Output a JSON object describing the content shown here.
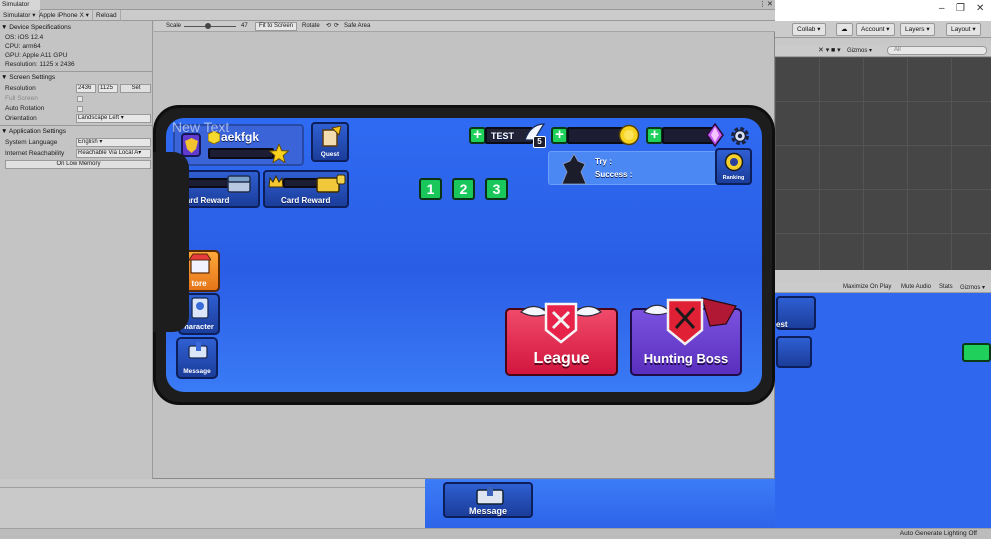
{
  "window": {
    "tab_title": "Simulator",
    "controls": [
      "–",
      "❐",
      "✕"
    ]
  },
  "sim_toolbar": {
    "mode": "Simulator ▾",
    "device": "Apple iPhone X ▾",
    "reload": "Reload"
  },
  "device_specs": {
    "header": "Device Specifications",
    "os": "OS: iOS 12.4",
    "cpu": "CPU: arm64",
    "gpu": "GPU: Apple A11 GPU",
    "resolution": "Resolution: 1125 x 2436"
  },
  "screen_settings": {
    "header": "Screen Settings",
    "resolution_label": "Resolution",
    "res_w": "2436",
    "res_h": "1125",
    "set_label": "Set",
    "full_screen": "Full Screen",
    "auto_rotation": "Auto Rotation",
    "orientation_label": "Orientation",
    "orientation_value": "Landscape Left ▾"
  },
  "app_settings": {
    "header": "Application Settings",
    "language_label": "System Language",
    "language_value": "English ▾",
    "reachability_label": "Internet Reachability",
    "reachability_value": "Reachable Via Local A▾",
    "low_memory": "On Low Memory"
  },
  "device_toolbar": {
    "scale_label": "Scale",
    "scale_value": "47",
    "fit": "Fit to Screen",
    "rotate": "Rotate",
    "safe_area": "Safe Area"
  },
  "editor": {
    "collab": "Collab ▾",
    "account": "Account ▾",
    "layers": "Layers ▾",
    "layout": "Layout ▾",
    "gizmos": "Gizmos ▾",
    "search_placeholder": "All",
    "game_toolbar": [
      "Maximize On Play",
      "Mute Audio",
      "Stats",
      "Gizmos ▾"
    ],
    "status": "Auto Generate Lighting Off"
  },
  "game": {
    "ghost_text": "New Text",
    "player_name": "aekfgk",
    "quest": "Quest",
    "test_label": "TEST",
    "test_count": "5",
    "try_label": "Try :",
    "success_label": "Success :",
    "ranking": "Ranking",
    "card_reward_1": "Card Reward",
    "card_reward_2": "Card Reward",
    "page_buttons": [
      "1",
      "2",
      "3"
    ],
    "store": "tore",
    "character": "haracter",
    "message": "Message",
    "league": "League",
    "hunting_boss": "Hunting Boss"
  },
  "behind": {
    "message": "Message",
    "quest_partial": "est"
  },
  "colors": {
    "game_blue": "#2f6bf2",
    "green": "#1fd05a",
    "league_red": "#e8234a",
    "boss_purple": "#6a3fc9"
  }
}
